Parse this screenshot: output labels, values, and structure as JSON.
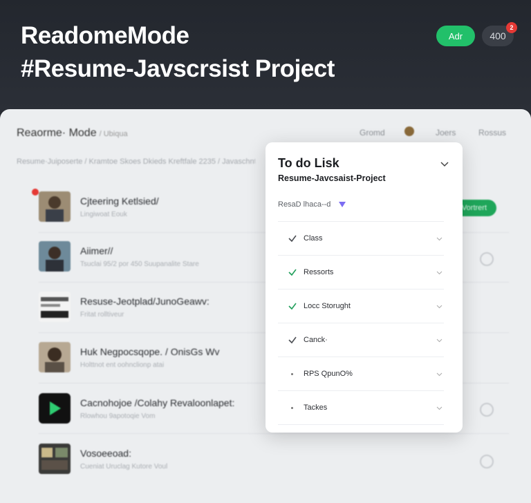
{
  "header": {
    "title_line1": "ReadomeMode",
    "title_line2": "#Resume-Javscrsist Project",
    "green_button": "Adr",
    "pill_value": "400"
  },
  "app": {
    "title": "Reaorme· Mode",
    "title_sub": "/ Ubiqua",
    "nav": [
      "Gromd",
      "Joers",
      "Rossus"
    ],
    "breadcrumb": "Resume·Juiposerte / Kramtoe Skoes Dkieds Kreftfale 2235 / Javaschnt / Gansseuie",
    "green_tag": "Vortrert",
    "rows": [
      {
        "title": "Cjteering Ketlsied/",
        "sub": "Lingiwoat Eouk"
      },
      {
        "title": "Aiimer//",
        "sub": "Tsuclai 95/2 por 450 Suupanalite Stare"
      },
      {
        "title": "Resuse-Jeotplad/JunoGeawv:",
        "sub": "Fritat rolltiveur"
      },
      {
        "title": "Huk Negpocsqope. / OnisGs Wv",
        "sub": "Holttnot ent oohnclionp atai"
      },
      {
        "title": "Cacnohojoe /Colahy Revaloonlapet:",
        "sub": "Rlowhou 9apotoqie Vom"
      },
      {
        "title": "Vosoeeoad:",
        "sub": "Cueniat Uruclag Kutore Voul"
      }
    ]
  },
  "modal": {
    "title": "To do Lisk",
    "subtitle": "Resume-Javcsaist-Project",
    "filter_label": "ResaD lhaca--d",
    "items": [
      {
        "label": "Class",
        "checked": true,
        "color": "#4a4d52"
      },
      {
        "label": "Ressorts",
        "checked": true,
        "color": "#1f9e5a"
      },
      {
        "label": "Locc Storught",
        "checked": true,
        "color": "#1f9e5a"
      },
      {
        "label": "Canck·",
        "checked": true,
        "color": "#4a4d52"
      },
      {
        "label": "RPS QpunO%",
        "checked": false,
        "color": "#4a4d52"
      },
      {
        "label": "Tackes",
        "checked": false,
        "color": "#4a4d52"
      }
    ]
  },
  "colors": {
    "accent_green": "#22c06a",
    "notification_red": "#e53935",
    "filter_triangle": "#7c6df2"
  },
  "icons": [
    "chevron-down-icon",
    "check-icon",
    "caret-down-icon",
    "bullet-icon",
    "play-icon",
    "notification-dot"
  ]
}
